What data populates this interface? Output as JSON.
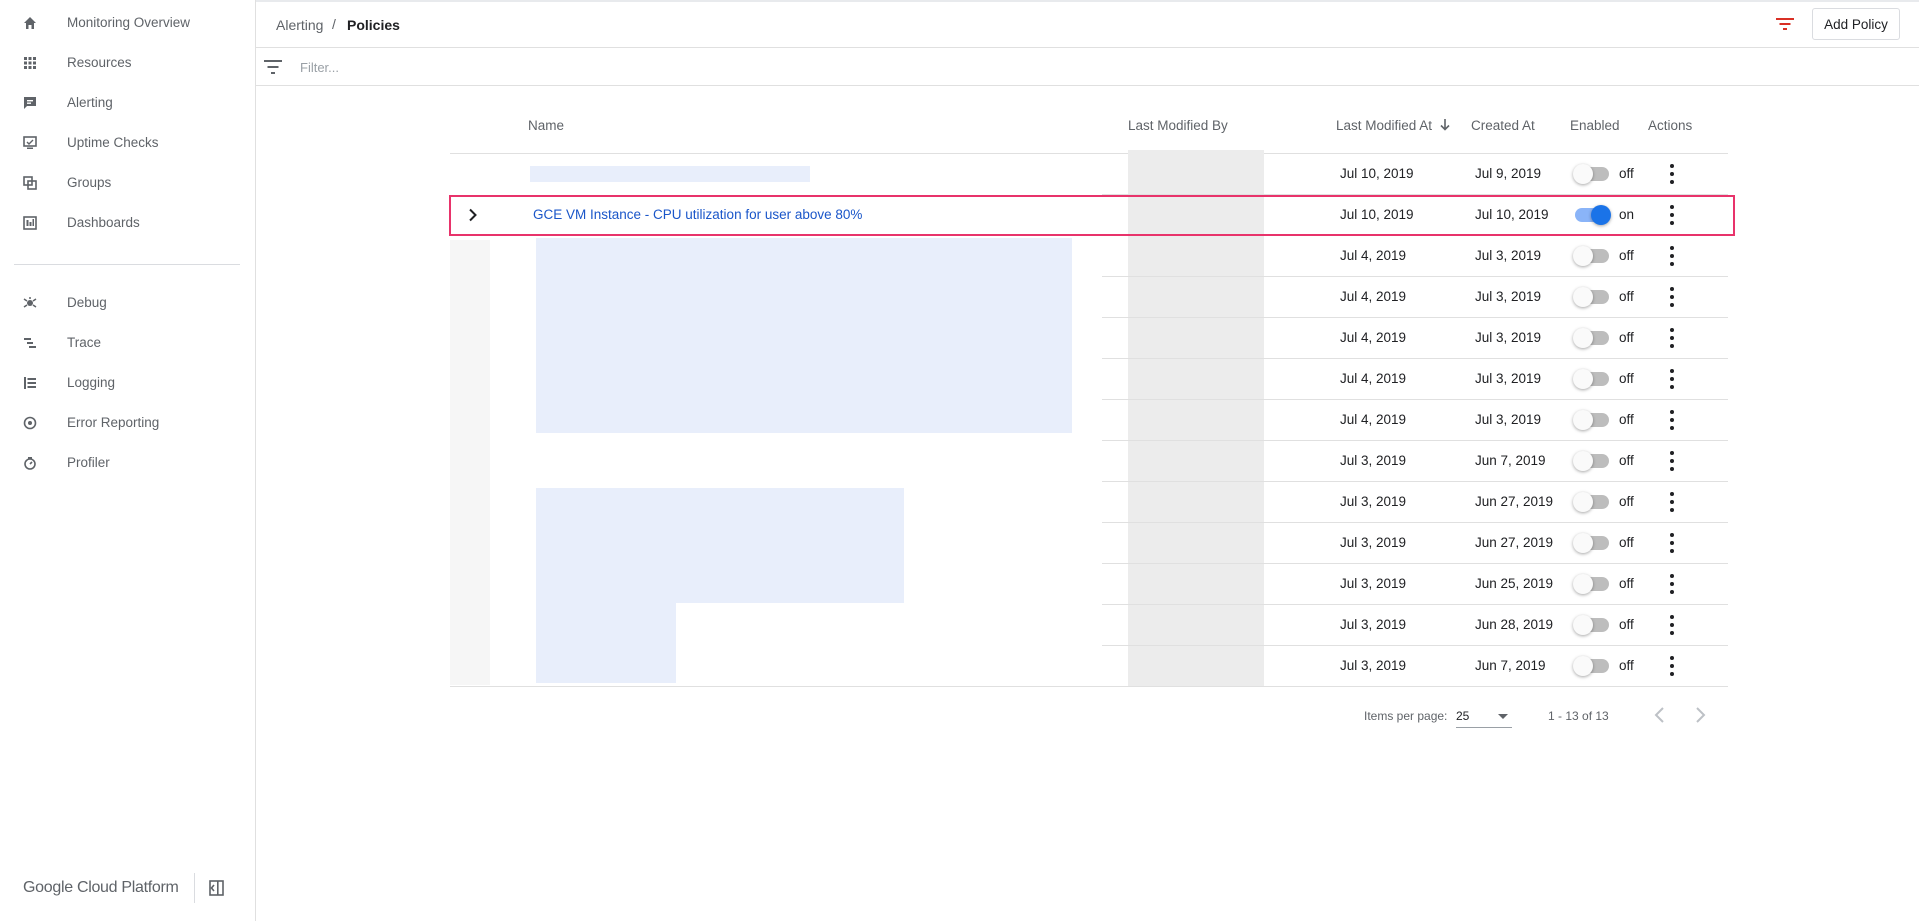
{
  "sidebar": {
    "items": [
      {
        "label": "Monitoring Overview",
        "icon": "home-icon"
      },
      {
        "label": "Resources",
        "icon": "grid-icon"
      },
      {
        "label": "Alerting",
        "icon": "chat-alert-icon"
      },
      {
        "label": "Uptime Checks",
        "icon": "monitor-check-icon"
      },
      {
        "label": "Groups",
        "icon": "groups-icon"
      },
      {
        "label": "Dashboards",
        "icon": "dashboard-icon"
      },
      {
        "label": "Debug",
        "icon": "debug-icon"
      },
      {
        "label": "Trace",
        "icon": "trace-icon"
      },
      {
        "label": "Logging",
        "icon": "logging-icon"
      },
      {
        "label": "Error Reporting",
        "icon": "error-reporting-icon"
      },
      {
        "label": "Profiler",
        "icon": "profiler-icon"
      }
    ],
    "brand": "Google Cloud Platform"
  },
  "header": {
    "breadcrumb_parent": "Alerting",
    "breadcrumb_sep": "/",
    "breadcrumb_current": "Policies",
    "add_policy_label": "Add Policy"
  },
  "filter": {
    "placeholder": "Filter..."
  },
  "table": {
    "columns": {
      "name": "Name",
      "last_modified_by": "Last Modified By",
      "last_modified_at": "Last Modified At",
      "created_at": "Created At",
      "enabled": "Enabled",
      "actions": "Actions"
    },
    "rows": [
      {
        "name": "",
        "modified": "Jul 10, 2019",
        "created": "Jul 9, 2019",
        "enabled": "off"
      },
      {
        "name": "GCE VM Instance - CPU utilization for user above 80%",
        "modified": "Jul 10, 2019",
        "created": "Jul 10, 2019",
        "enabled": "on"
      },
      {
        "name": "",
        "modified": "Jul 4, 2019",
        "created": "Jul 3, 2019",
        "enabled": "off"
      },
      {
        "name": "",
        "modified": "Jul 4, 2019",
        "created": "Jul 3, 2019",
        "enabled": "off"
      },
      {
        "name": "",
        "modified": "Jul 4, 2019",
        "created": "Jul 3, 2019",
        "enabled": "off"
      },
      {
        "name": "",
        "modified": "Jul 4, 2019",
        "created": "Jul 3, 2019",
        "enabled": "off"
      },
      {
        "name": "",
        "modified": "Jul 4, 2019",
        "created": "Jul 3, 2019",
        "enabled": "off"
      },
      {
        "name": "",
        "modified": "Jul 3, 2019",
        "created": "Jun 7, 2019",
        "enabled": "off"
      },
      {
        "name": "",
        "modified": "Jul 3, 2019",
        "created": "Jun 27, 2019",
        "enabled": "off"
      },
      {
        "name": "",
        "modified": "Jul 3, 2019",
        "created": "Jun 27, 2019",
        "enabled": "off"
      },
      {
        "name": "",
        "modified": "Jul 3, 2019",
        "created": "Jun 25, 2019",
        "enabled": "off"
      },
      {
        "name": "",
        "modified": "Jul 3, 2019",
        "created": "Jun 28, 2019",
        "enabled": "off"
      },
      {
        "name": "",
        "modified": "Jul 3, 2019",
        "created": "Jun 7, 2019",
        "enabled": "off"
      }
    ]
  },
  "paginator": {
    "items_per_page_label": "Items per page:",
    "items_per_page_value": "25",
    "range_label": "1 - 13 of 13"
  },
  "colors": {
    "accent": "#1a73e8",
    "highlight": "#e8336b",
    "filter_icon": "#d93025"
  }
}
